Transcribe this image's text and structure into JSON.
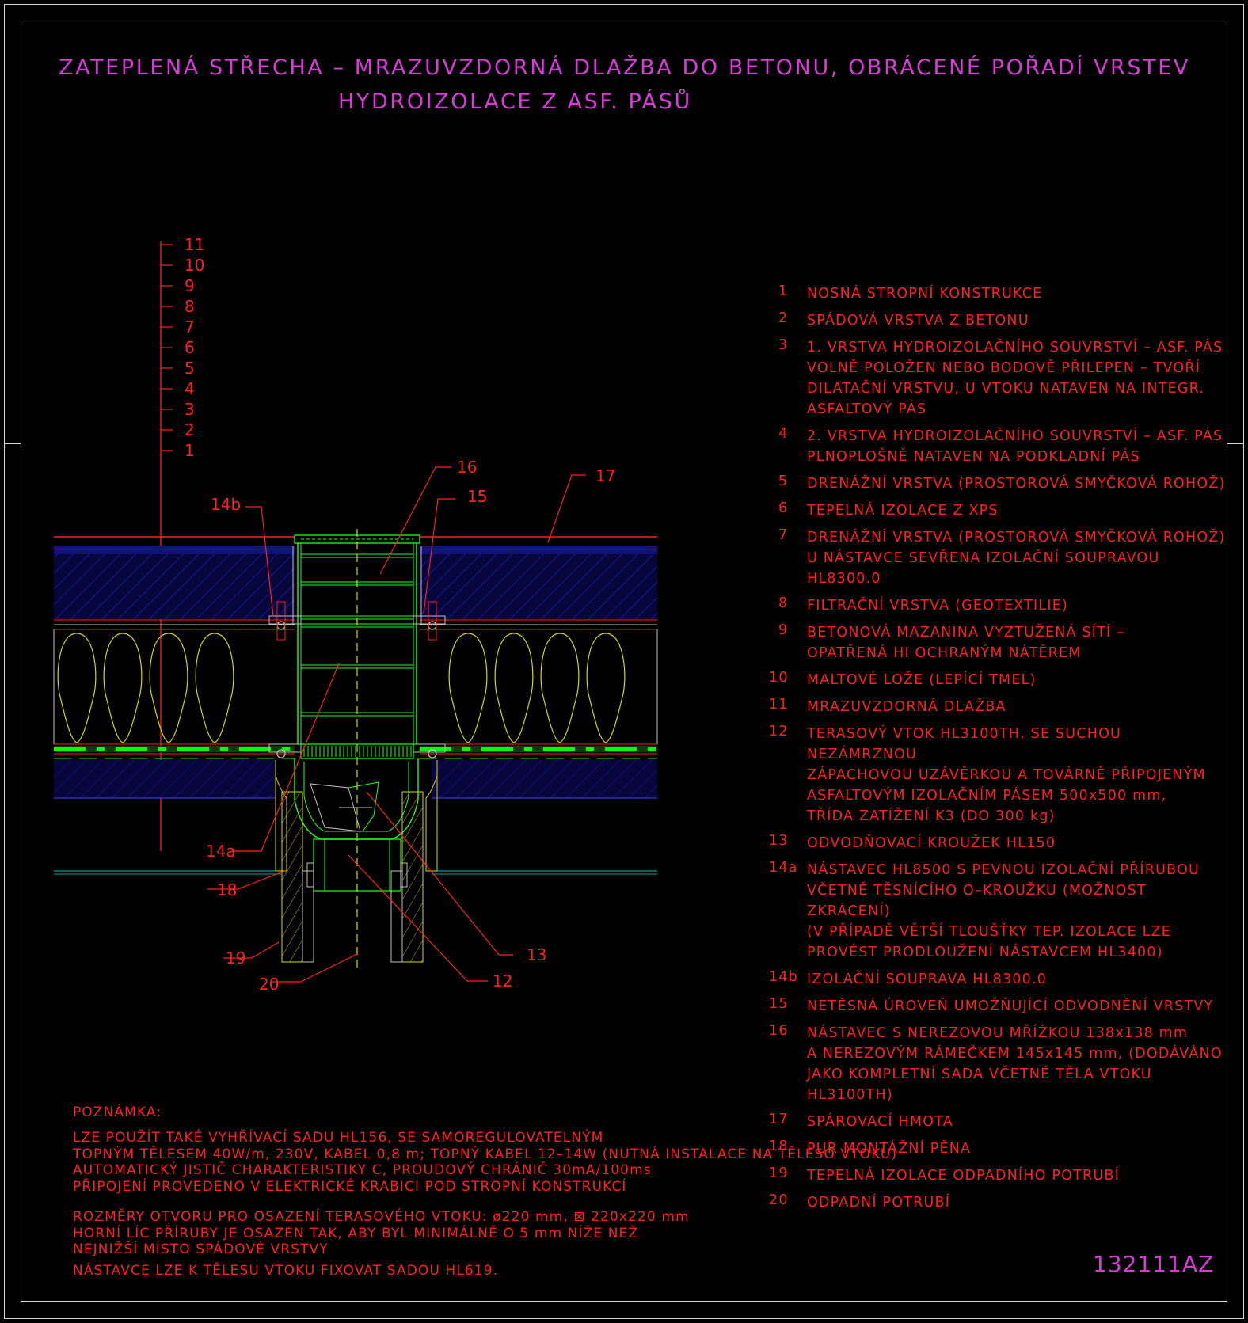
{
  "title": {
    "line1": "ZATEPLENÁ STŘECHA – MRAZUVZDORNÁ DLAŽBA DO BETONU, OBRÁCENÉ POŘADÍ VRSTEV",
    "line2": "HYDROIZOLACE Z ASF. PÁSŮ"
  },
  "layer_scale": [
    "11",
    "10",
    "9",
    "8",
    "7",
    "6",
    "5",
    "4",
    "3",
    "2",
    "1"
  ],
  "callouts": {
    "c16": "16",
    "c15": "15",
    "c17": "17",
    "c14b": "14b",
    "c14a": "14a",
    "c18": "18",
    "c19": "19",
    "c20": "20",
    "c13": "13",
    "c12": "12"
  },
  "legend": [
    {
      "num": "1",
      "lines": [
        "NOSNÁ STROPNÍ KONSTRUKCE"
      ]
    },
    {
      "num": "2",
      "lines": [
        "SPÁDOVÁ VRSTVA Z BETONU"
      ]
    },
    {
      "num": "3",
      "lines": [
        "1. VRSTVA HYDROIZOLAČNÍHO SOUVRSTVÍ – ASF. PÁS",
        "VOLNĚ POLOŽEN NEBO BODOVĚ PŘILEPEN – TVOŘÍ",
        "DILATAČNÍ VRSTVU, U VTOKU NATAVEN NA INTEGR.",
        "ASFALTOVÝ PÁS"
      ]
    },
    {
      "num": "4",
      "lines": [
        "2. VRSTVA HYDROIZOLAČNÍHO SOUVRSTVÍ – ASF. PÁS",
        "PLNOPLOŠNĚ NATAVEN NA PODKLADNÍ PÁS"
      ]
    },
    {
      "num": "5",
      "lines": [
        "DRENÁŽNÍ VRSTVA (PROSTOROVÁ SMYČKOVÁ ROHOŽ)"
      ]
    },
    {
      "num": "6",
      "lines": [
        "TEPELNÁ IZOLACE Z XPS"
      ]
    },
    {
      "num": "7",
      "lines": [
        "DRENÁŽNÍ VRSTVA (PROSTOROVÁ SMYČKOVÁ ROHOŽ)",
        "U NÁSTAVCE SEVŘENA IZOLAČNÍ SOUPRAVOU HL8300.0"
      ]
    },
    {
      "num": "8",
      "lines": [
        "FILTRAČNÍ VRSTVA (GEOTEXTILIE)"
      ]
    },
    {
      "num": "9",
      "lines": [
        "BETONOVÁ MAZANINA VYZTUŽENÁ SÍTÍ –",
        "OPATŘENÁ HI OCHRANÝM NÁTĚREM"
      ]
    },
    {
      "num": "10",
      "lines": [
        "MALTOVÉ LOŽE (LEPÍCÍ TMEL)"
      ]
    },
    {
      "num": "11",
      "lines": [
        "MRAZUVZDORNÁ DLAŽBA"
      ]
    },
    {
      "num": "12",
      "lines": [
        "TERASOVÝ VTOK HL3100TH, SE SUCHOU NEZÁMRZNOU",
        "ZÁPACHOVOU UZÁVĚRKOU A TOVÁRNĚ PŘIPOJENÝM",
        "ASFALTOVÝM IZOLAČNÍM PÁSEM 500x500 mm,",
        "TŘÍDA ZATÍŽENÍ K3 (DO 300 kg)"
      ]
    },
    {
      "num": "13",
      "lines": [
        "ODVODŇOVACÍ KROUŽEK HL150"
      ]
    },
    {
      "num": "14a",
      "lines": [
        "NÁSTAVEC HL8500 S PEVNOU IZOLAČNÍ PŘÍRUBOU",
        "VČETNĚ TĚSNÍCÍHO O–KROUŽKU (MOŽNOST ZKRÁCENÍ)",
        "(V PŘÍPADĚ VĚTŠÍ TLOUŠŤKY TEP. IZOLACE LZE",
        "PROVÉST PRODLOUŽENÍ NÁSTAVCEM HL3400)"
      ]
    },
    {
      "num": "14b",
      "lines": [
        "IZOLAČNÍ SOUPRAVA HL8300.0"
      ]
    },
    {
      "num": "15",
      "lines": [
        "NETĚSNÁ ÚROVEŇ UMOŽŇUJÍCÍ ODVODNĚNÍ VRSTVY"
      ]
    },
    {
      "num": "16",
      "lines": [
        "NÁSTAVEC S NEREZOVOU MŘÍŽKOU 138x138 mm",
        "A NEREZOVÝM RÁMEČKEM 145x145 mm, (DODÁVÁNO",
        "JAKO KOMPLETNÍ SADA VČETNĚ TĚLA VTOKU HL3100TH)"
      ]
    },
    {
      "num": "17",
      "lines": [
        "SPÁROVACÍ HMOTA"
      ]
    },
    {
      "num": "18",
      "lines": [
        "PUR MONTÁŽNÍ PĚNA"
      ]
    },
    {
      "num": "19",
      "lines": [
        "TEPELNÁ IZOLACE ODPADNÍHO POTRUBÍ"
      ]
    },
    {
      "num": "20",
      "lines": [
        "ODPADNÍ POTRUBÍ"
      ]
    }
  ],
  "note": {
    "heading": "POZNÁMKA:",
    "p1": [
      "LZE POUŽÍT TAKÉ VYHŘÍVACÍ SADU HL156, SE SAMOREGULOVATELNÝM",
      "TOPNÝM TĚLESEM 40W/m, 230V, KABEL 0,8 m; TOPNÝ KABEL 12–14W (NUTNÁ INSTALACE NA TĚLESO VTOKU)",
      "AUTOMATICKÝ JISTIČ CHARAKTERISTIKY C, PROUDOVÝ CHRÁNIČ 30mA/100ms",
      "PŘIPOJENÍ PROVEDENO V ELEKTRICKÉ KRABICI POD STROPNÍ KONSTRUKCÍ"
    ],
    "p2": [
      "ROZMĚRY OTVORU PRO OSAZENÍ TERASOVÉHO VTOKU: ø220 mm, ⊠ 220x220 mm",
      "HORNÍ LÍC PŘÍRUBY JE OSAZEN TAK, ABY BYL MINIMÁLNĚ O 5 mm NÍŽE NEŽ",
      "NEJNIŽŠÍ MÍSTO SPÁDOVÉ VRSTVY"
    ],
    "p3": "NÁSTAVCE LZE K TĚLESU VTOKU FIXOVAT SADOU HL619."
  },
  "drawing_code": "132111AZ",
  "colors": {
    "title": "#d93bd9",
    "text": "#ff2020",
    "concrete": "#1a1aa0",
    "insulation": "#d8d800",
    "membrane": "#00e000",
    "drain": "#20ff20",
    "frame": "#d8d8d8"
  }
}
